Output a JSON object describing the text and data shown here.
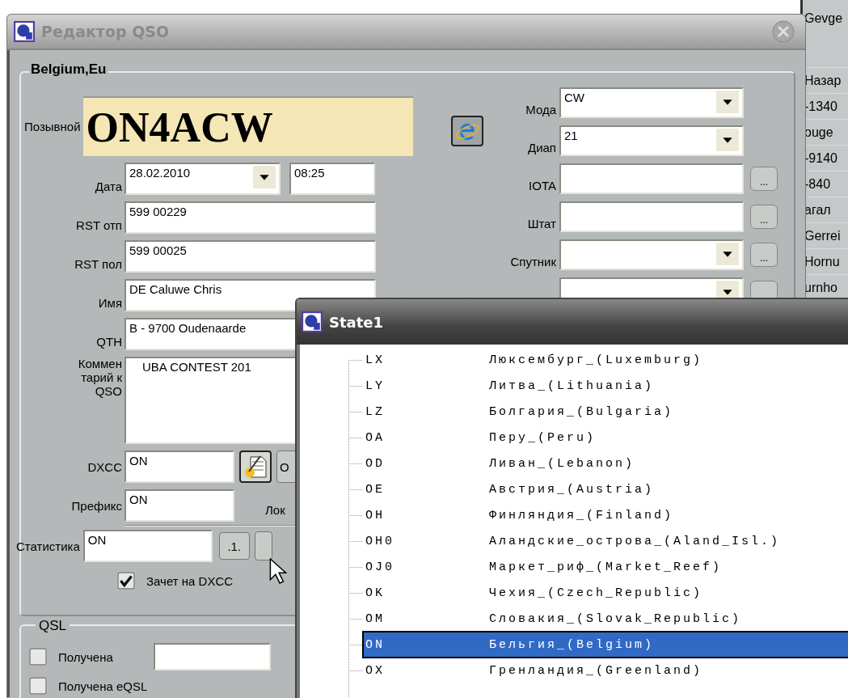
{
  "background_list": [
    "Gevge",
    "Назар",
    "-1340",
    "ouge",
    "-9140",
    "-840",
    "агал",
    "Gerrei",
    "Hornu",
    "urnho"
  ],
  "editor": {
    "title": "Редактор QSO",
    "group_title": "Belgium,Eu",
    "callsign_label": "Позывной",
    "callsign": "ON4ACW",
    "date": {
      "label": "Дата",
      "value": "28.02.2010"
    },
    "time": "08:25",
    "fields": [
      {
        "label": "RST отп",
        "value": "599 00229"
      },
      {
        "label": "RST пол",
        "value": "599 00025"
      },
      {
        "label": "Имя",
        "value": "DE Caluwe Chris"
      },
      {
        "label": "QTH",
        "value": "B - 9700 Oudenaarde"
      }
    ],
    "comment": {
      "label": "Коммен тарий к QSO",
      "value": "UBA CONTEST 201"
    },
    "dxcc": {
      "label": "DXCC",
      "value": "ON",
      "button": "О"
    },
    "prefix": {
      "label": "Префикс",
      "value": "ON",
      "locator_label": "Лок"
    },
    "statistics": {
      "label": "Статистика",
      "value": "ON",
      "button": ".1."
    },
    "credit_checkbox": {
      "label": "Зачет на DXCC",
      "checked": true
    },
    "right_fields": [
      {
        "label": "Мода",
        "value": "CW",
        "kind": "combo"
      },
      {
        "label": "Диап",
        "value": "21",
        "kind": "combo"
      },
      {
        "label": "IOTA",
        "kind": "text",
        "button": "..."
      },
      {
        "label": "Штат",
        "kind": "text",
        "button": "..."
      },
      {
        "label": "Спутник",
        "kind": "combo",
        "button": "..."
      },
      {
        "kind": "combo",
        "more": true
      }
    ],
    "qsl": {
      "title": "QSL",
      "items": [
        {
          "label": "Получена",
          "checked": false,
          "field": true
        },
        {
          "label": "Получена eQSL",
          "checked": false,
          "field": false
        }
      ]
    }
  },
  "state_window": {
    "title": "State1",
    "rows": [
      {
        "code": "LX",
        "name": "Люксембург_(Luxemburg)",
        "selected": false
      },
      {
        "code": "LY",
        "name": "Литва_(Lithuania)",
        "selected": false
      },
      {
        "code": "LZ",
        "name": "Болгария_(Bulgaria)",
        "selected": false
      },
      {
        "code": "OA",
        "name": "Перу_(Peru)",
        "selected": false
      },
      {
        "code": "OD",
        "name": "Ливан_(Lebanon)",
        "selected": false
      },
      {
        "code": "OE",
        "name": "Австрия_(Austria)",
        "selected": false
      },
      {
        "code": "OH",
        "name": "Финляндия_(Finland)",
        "selected": false
      },
      {
        "code": "OH0",
        "name": "Аландские_острова_(Aland_Isl.)",
        "selected": false
      },
      {
        "code": "OJ0",
        "name": "Маркет_риф_(Market_Reef)",
        "selected": false
      },
      {
        "code": "OK",
        "name": "Чехия_(Czech_Republic)",
        "selected": false
      },
      {
        "code": "OM",
        "name": "Словакия_(Slovak_Republic)",
        "selected": false
      },
      {
        "code": "ON",
        "name": "Бельгия_(Belgium)",
        "selected": true
      },
      {
        "code": "OX",
        "name": "Гренландия_(Greenland)",
        "selected": false
      }
    ]
  }
}
